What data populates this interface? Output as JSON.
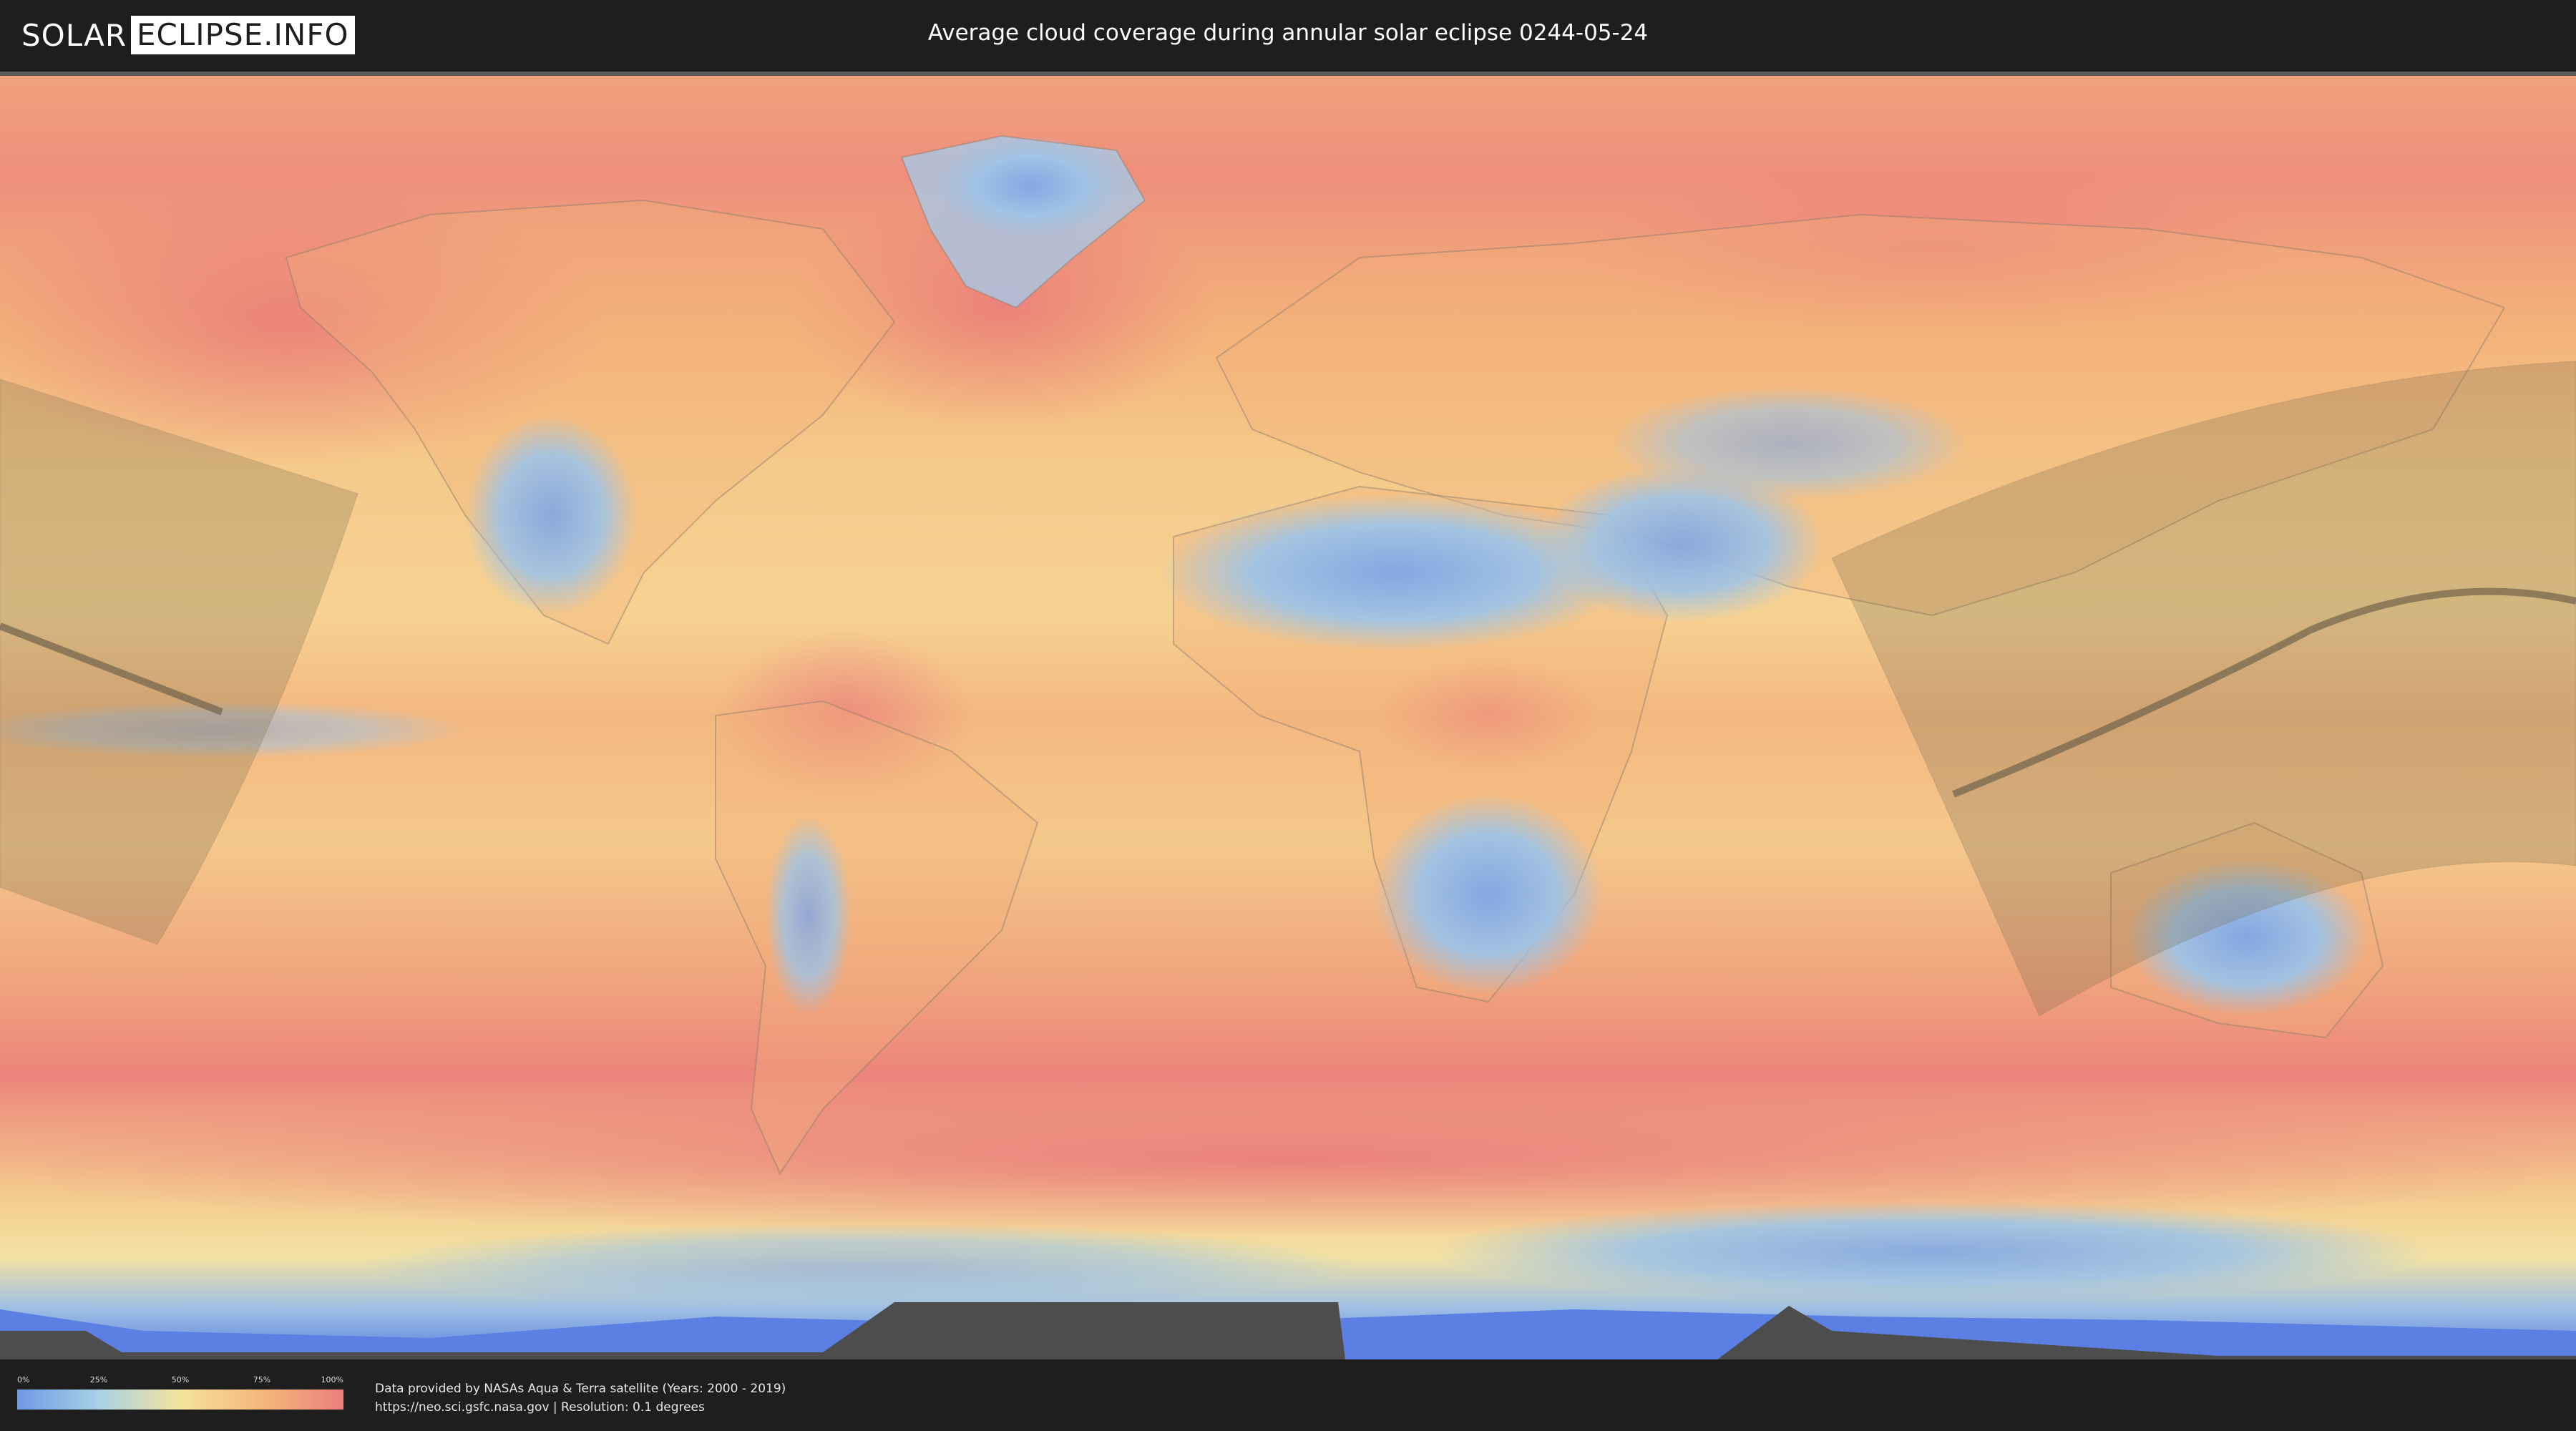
{
  "header": {
    "logo_left": "SOLAR",
    "logo_right": "ECLIPSE.INFO",
    "title": "Average cloud coverage during annular solar eclipse 0244-05-24"
  },
  "legend": {
    "ticks": [
      "0%",
      "25%",
      "50%",
      "75%",
      "100%"
    ],
    "colors": [
      "#6f9ae6",
      "#a8d0e6",
      "#f5e39b",
      "#f4b77a",
      "#ec7f7d"
    ]
  },
  "footer": {
    "credit_line1": "Data provided by NASAs Aqua & Terra satellite (Years: 2000 - 2019)",
    "credit_line2": "https://neo.sci.gsfc.nasa.gov | Resolution: 0.1 degrees"
  },
  "map": {
    "projection": "equirectangular",
    "cloud_color_low": "#6f9ae6",
    "cloud_color_high": "#ec7f7d",
    "eclipse_path_color": "#7a6a4a"
  }
}
